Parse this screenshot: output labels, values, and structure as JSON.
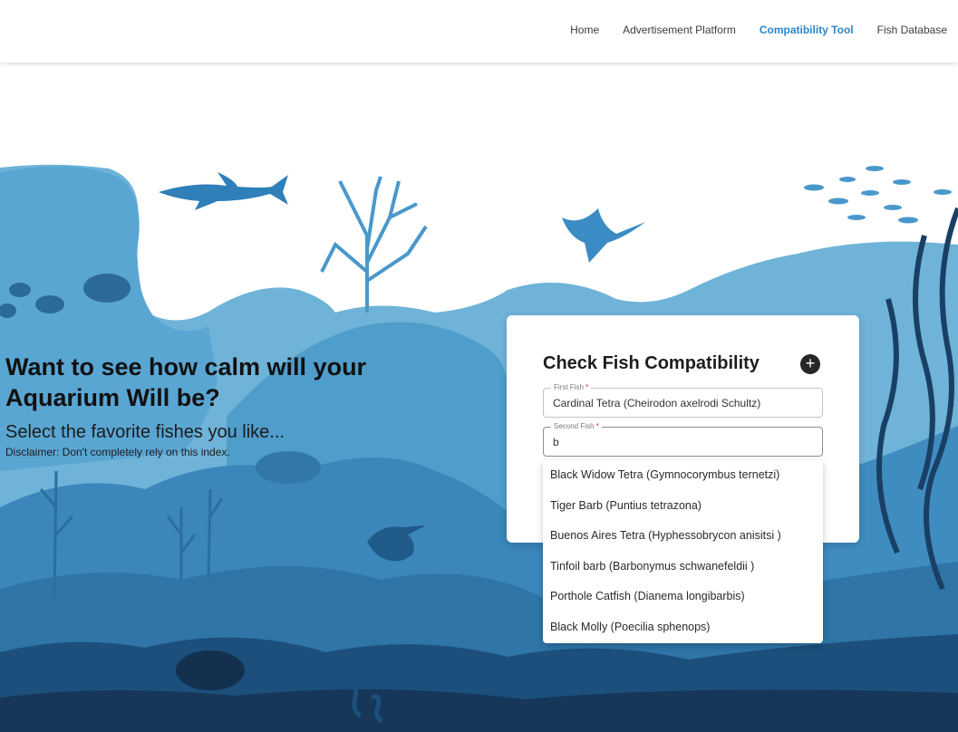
{
  "nav": {
    "items": [
      {
        "label": "Home"
      },
      {
        "label": "Advertisement Platform"
      },
      {
        "label": "Compatibility Tool"
      },
      {
        "label": "Fish Database"
      }
    ],
    "active": "Compatibility Tool",
    "accent_color": "#2b87c8"
  },
  "hero": {
    "title": "Want to see how calm will your Aquarium Will be?",
    "subtitle": "Select the favorite fishes you like...",
    "disclaimer": "Disclaimer: Don't completely rely on this index."
  },
  "card": {
    "title": "Check Fish Compatibility",
    "add_icon": "plus-icon",
    "first_fish": {
      "label": "First Fish",
      "required_mark": "*",
      "value": "Cardinal Tetra (Cheirodon axelrodi Schultz)"
    },
    "second_fish": {
      "label": "Second Fish",
      "required_mark": "*",
      "value": "b"
    }
  },
  "dropdown": {
    "options": [
      {
        "label": "Black Widow Tetra (Gymnocorymbus ternetzi)"
      },
      {
        "label": "Tiger Barb (Puntius tetrazona)"
      },
      {
        "label": "Buenos Aires Tetra (Hyphessobrycon anisitsi )"
      },
      {
        "label": "Tinfoil barb (Barbonymus schwanefeldii )"
      },
      {
        "label": "Porthole Catfish (Dianema longibarbis)"
      },
      {
        "label": "Black Molly (Poecilia sphenops)"
      }
    ]
  },
  "scene_colors": {
    "light": "#6fb3d8",
    "mid": "#4f9dcb",
    "deep": "#2f75a8",
    "dark": "#1c4f7c",
    "darkest": "#16375a"
  }
}
